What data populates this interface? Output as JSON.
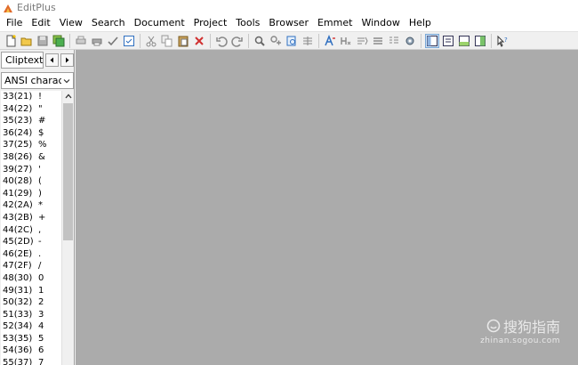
{
  "window": {
    "title": "EditPlus"
  },
  "menu": [
    "File",
    "Edit",
    "View",
    "Search",
    "Document",
    "Project",
    "Tools",
    "Browser",
    "Emmet",
    "Window",
    "Help"
  ],
  "sidebar": {
    "tab_label": "Cliptext",
    "charset_value": "ANSI characters",
    "rows": [
      {
        "code": "33(21)",
        "ch": "!"
      },
      {
        "code": "34(22)",
        "ch": "\""
      },
      {
        "code": "35(23)",
        "ch": "#"
      },
      {
        "code": "36(24)",
        "ch": "$"
      },
      {
        "code": "37(25)",
        "ch": "%"
      },
      {
        "code": "38(26)",
        "ch": "&"
      },
      {
        "code": "39(27)",
        "ch": "'"
      },
      {
        "code": "40(28)",
        "ch": "("
      },
      {
        "code": "41(29)",
        "ch": ")"
      },
      {
        "code": "42(2A)",
        "ch": "*"
      },
      {
        "code": "43(2B)",
        "ch": "+"
      },
      {
        "code": "44(2C)",
        "ch": ","
      },
      {
        "code": "45(2D)",
        "ch": "-"
      },
      {
        "code": "46(2E)",
        "ch": "."
      },
      {
        "code": "47(2F)",
        "ch": "/"
      },
      {
        "code": "48(30)",
        "ch": "0"
      },
      {
        "code": "49(31)",
        "ch": "1"
      },
      {
        "code": "50(32)",
        "ch": "2"
      },
      {
        "code": "51(33)",
        "ch": "3"
      },
      {
        "code": "52(34)",
        "ch": "4"
      },
      {
        "code": "53(35)",
        "ch": "5"
      },
      {
        "code": "54(36)",
        "ch": "6"
      },
      {
        "code": "55(37)",
        "ch": "7"
      }
    ]
  },
  "watermark": {
    "main": "搜狗指南",
    "sub": "zhinan.sogou.com"
  },
  "colors": {
    "editor_bg": "#ababab",
    "accent_blue": "#2f6fc0",
    "icon_red": "#d03030"
  }
}
